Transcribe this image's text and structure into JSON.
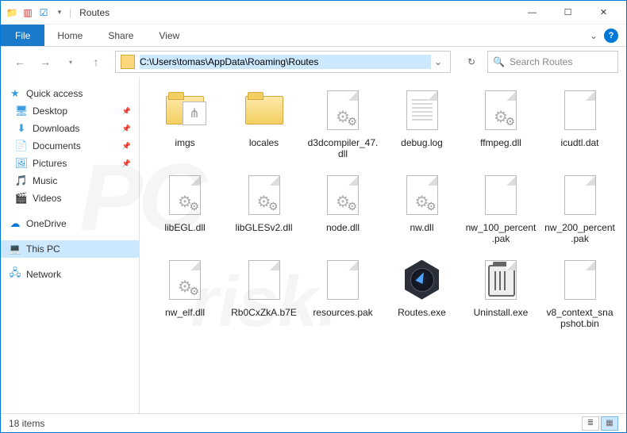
{
  "window": {
    "title": "Routes",
    "min": "—",
    "max": "☐",
    "close": "✕"
  },
  "ribbon": {
    "file": "File",
    "home": "Home",
    "share": "Share",
    "view": "View"
  },
  "nav": {
    "address": "C:\\Users\\tomas\\AppData\\Roaming\\Routes",
    "search_placeholder": "Search Routes"
  },
  "sidebar": {
    "quick": "Quick access",
    "desktop": "Desktop",
    "downloads": "Downloads",
    "documents": "Documents",
    "pictures": "Pictures",
    "music": "Music",
    "videos": "Videos",
    "onedrive": "OneDrive",
    "thispc": "This PC",
    "network": "Network"
  },
  "files": [
    {
      "name": "imgs",
      "type": "folder-thumb"
    },
    {
      "name": "locales",
      "type": "folder"
    },
    {
      "name": "d3dcompiler_47.dll",
      "type": "dll"
    },
    {
      "name": "debug.log",
      "type": "log"
    },
    {
      "name": "ffmpeg.dll",
      "type": "dll"
    },
    {
      "name": "icudtl.dat",
      "type": "file"
    },
    {
      "name": "libEGL.dll",
      "type": "dll"
    },
    {
      "name": "libGLESv2.dll",
      "type": "dll"
    },
    {
      "name": "node.dll",
      "type": "dll"
    },
    {
      "name": "nw.dll",
      "type": "dll"
    },
    {
      "name": "nw_100_percent.pak",
      "type": "file"
    },
    {
      "name": "nw_200_percent.pak",
      "type": "file"
    },
    {
      "name": "nw_elf.dll",
      "type": "dll"
    },
    {
      "name": "Rb0CxZkA.b7E",
      "type": "file"
    },
    {
      "name": "resources.pak",
      "type": "file"
    },
    {
      "name": "Routes.exe",
      "type": "exe-hex"
    },
    {
      "name": "Uninstall.exe",
      "type": "exe-trash"
    },
    {
      "name": "v8_context_snapshot.bin",
      "type": "file"
    }
  ],
  "status": {
    "count": "18 items"
  }
}
